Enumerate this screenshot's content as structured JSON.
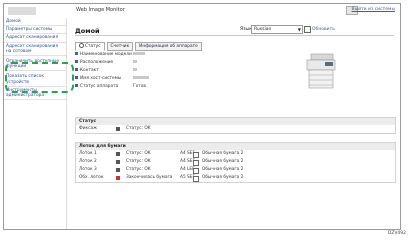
{
  "header": {
    "title": "Web Image Monitor",
    "top_right_link": "Выйти из системы"
  },
  "sidebar": {
    "items": [
      {
        "label": "Домой"
      },
      {
        "label": "Параметры системы"
      },
      {
        "label": "Адресат сканирования"
      },
      {
        "label": "Адресат сканирования на сотовом"
      },
      {
        "label": "Ограничить доступные функции"
      },
      {
        "label": "Показать список устройств"
      },
      {
        "label": "Инструменты администратора"
      }
    ]
  },
  "main": {
    "page_title": "Домой",
    "language_label": "Язык",
    "language_value": "Russian",
    "refresh_label": "Обновить",
    "tabs": [
      {
        "label": "Статус"
      },
      {
        "label": "Счетчик"
      },
      {
        "label": "Информация об аппарате"
      }
    ],
    "info": [
      {
        "label": "Наименование модели",
        "value": ""
      },
      {
        "label": "Расположение",
        "value": ""
      },
      {
        "label": "Контакт",
        "value": ""
      },
      {
        "label": "Имя хост-системы",
        "value": ""
      },
      {
        "label": "Статус аппарата",
        "value": "Готов"
      }
    ],
    "status_section": {
      "title": "Статус",
      "rows": [
        {
          "name": "Фиксаж",
          "status": "Статус: OK"
        }
      ]
    },
    "trays_section": {
      "title": "Лоток для бумаги",
      "rows": [
        {
          "name": "Лоток 1",
          "status": "Статус: OK",
          "size": "A4 SEF",
          "paper": "Обычная бумага 2",
          "alert": false
        },
        {
          "name": "Лоток 2",
          "status": "Статус: OK",
          "size": "A4 SEF",
          "paper": "Обычная бумага 2",
          "alert": false
        },
        {
          "name": "Лоток 3",
          "status": "Статус: OK",
          "size": "A4 LEF",
          "paper": "Обычная бумага 2",
          "alert": false
        },
        {
          "name": "Обх. лоток",
          "status": "Закончилась бумага",
          "size": "A5 SEF",
          "paper": "Обычная бумага 2",
          "alert": true
        }
      ]
    }
  },
  "footer_code": "DZV492"
}
